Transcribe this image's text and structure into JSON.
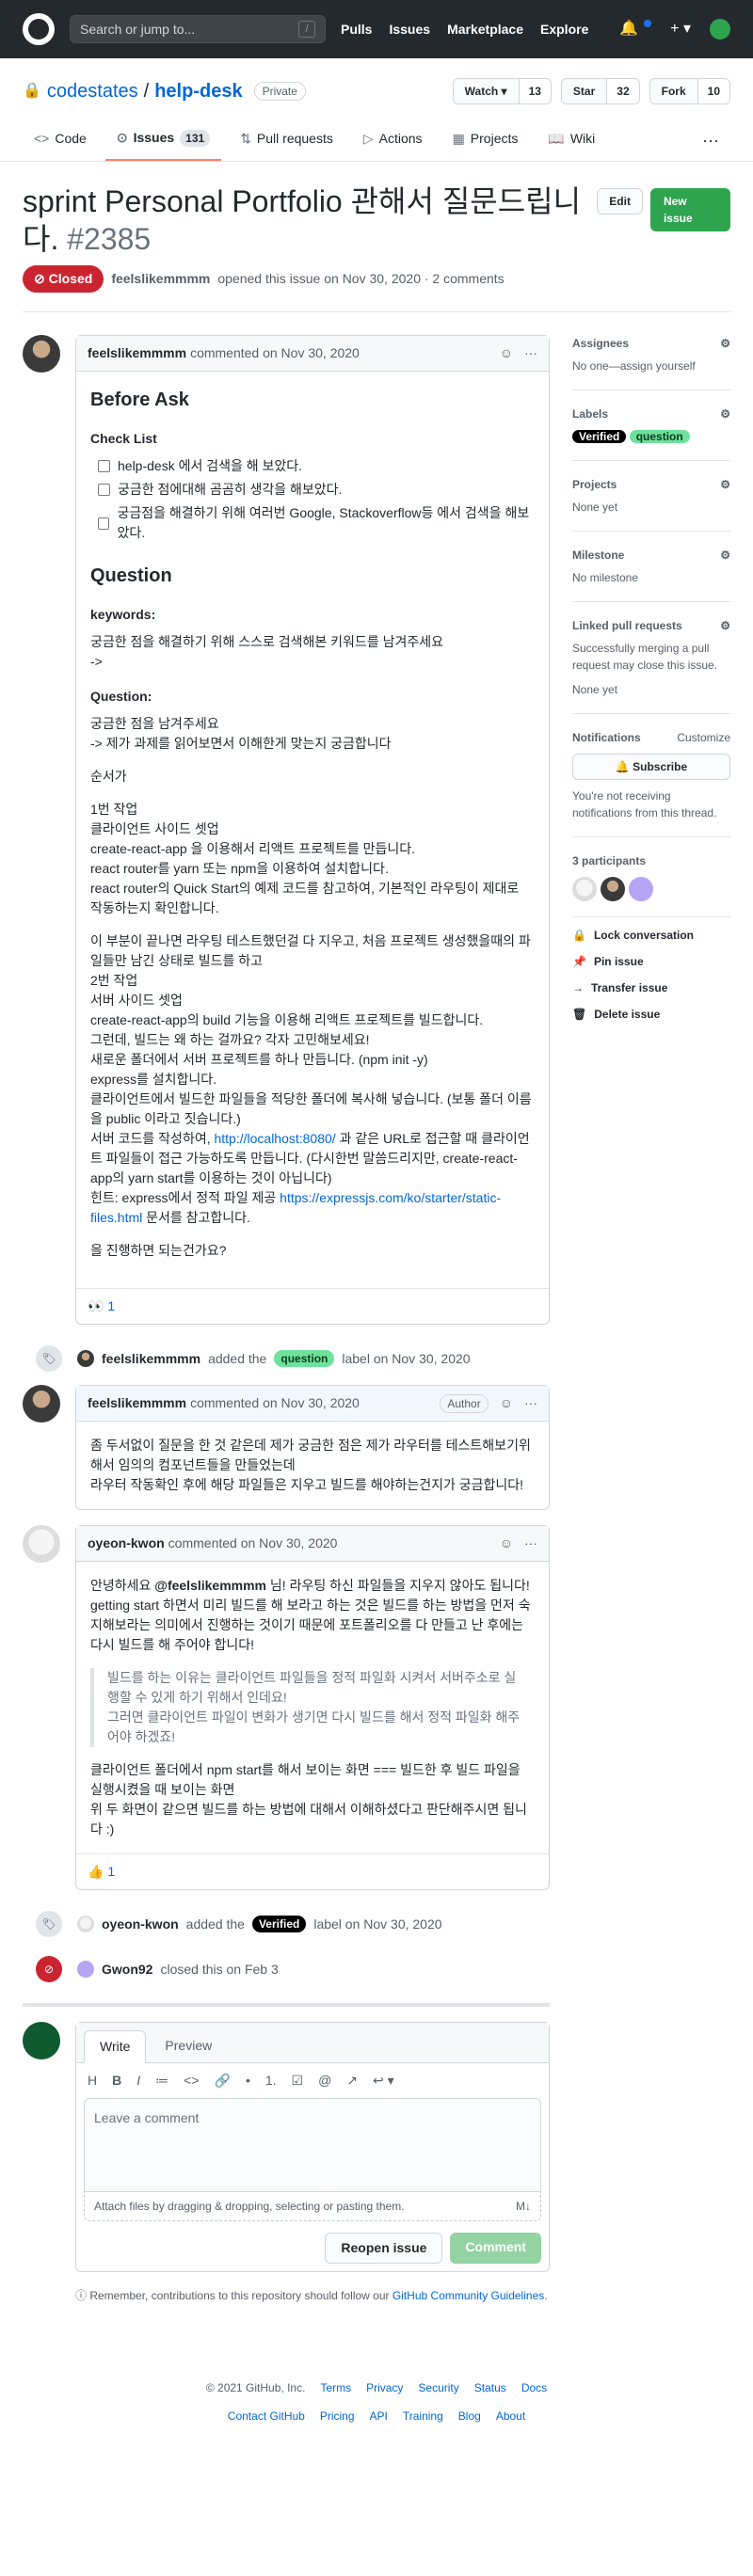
{
  "header": {
    "search_placeholder": "Search or jump to...",
    "slash": "/",
    "nav": [
      "Pulls",
      "Issues",
      "Marketplace",
      "Explore"
    ],
    "plus": "+ ▾"
  },
  "repo": {
    "owner": "codestates",
    "name": "help-desk",
    "visibility": "Private",
    "watch": "Watch ▾",
    "watch_count": "13",
    "star": "Star",
    "star_count": "32",
    "fork": "Fork",
    "fork_count": "10"
  },
  "tabs": {
    "code": "Code",
    "issues": "Issues",
    "issues_count": "131",
    "pulls": "Pull requests",
    "actions": "Actions",
    "projects": "Projects",
    "wiki": "Wiki"
  },
  "issue": {
    "title": "sprint Personal Portfolio 관해서 질문드립니다.",
    "number": "#2385",
    "edit": "Edit",
    "new_issue": "New issue",
    "status": "Closed",
    "author": "feelslikemmmm",
    "meta": "opened this issue on Nov 30, 2020 · 2 comments"
  },
  "c1": {
    "author": "feelslikemmmm",
    "meta": "commented on Nov 30, 2020",
    "h_before": "Before Ask",
    "h_check": "Check List",
    "checks": [
      "help-desk 에서 검색을 해 보았다.",
      "궁금한 점에대해 곰곰히 생각을 해보았다.",
      "궁금점을 해결하기 위해 여러번 Google, Stackoverflow등 에서 검색을 해보았다."
    ],
    "h_question": "Question",
    "h_keywords": "keywords:",
    "kw1": "궁금한 점을 해결하기 위해 스스로 검색해본 키워드를 남겨주세요",
    "kw2": "->",
    "h_q2": "Question:",
    "q1": "궁금한 점을 남겨주세요",
    "q2": "-> 제가 과제를 읽어보면서 이해한게 맞는지 궁금합니다",
    "order": "순서가",
    "s1": "1번 작업",
    "s2": "클라이언트 사이드 셋업",
    "s3": "create-react-app 을 이용해서 리액트 프로젝트를 만듭니다.",
    "s4": "react router를 yarn 또는 npm을 이용하여 설치합니다.",
    "s5": "react router의 Quick Start의 예제 코드를 참고하여, 기본적인 라우팅이 제대로 작동하는지 확인합니다.",
    "t1": "이 부분이 끝나면 라우팅 테스트했던걸 다 지우고, 처음 프로젝트 생성했을때의 파일들만 남긴 상태로 빌드를 하고",
    "t2": "2번 작업",
    "t3": "서버 사이드 셋업",
    "t4": "create-react-app의 build 기능을 이용해 리액트 프로젝트를 빌드합니다.",
    "t5": "그런데, 빌드는 왜 하는 걸까요? 각자 고민해보세요!",
    "t6": "새로운 폴더에서 서버 프로젝트를 하나 만듭니다. (npm init -y)",
    "t7": "express를 설치합니다.",
    "t8": "클라이언트에서 빌드한 파일들을 적당한 폴더에 복사해 넣습니다. (보통 폴더 이름을 public 이라고 짓습니다.)",
    "t9a": "서버 코드를 작성하여,",
    "t9link": "http://localhost:8080/",
    "t9b": "과 같은 URL로 접근할 때 클라이언트 파일들이 접근 가능하도록 만듭니다. (다시한번 말씀드리지만, create-react-app의 yarn start를 이용하는 것이 아닙니다)",
    "t10a": "힌트: express에서 정적 파일 제공",
    "t10link": "https://expressjs.com/ko/starter/static-files.html",
    "t10b": "문서를 참고합니다.",
    "ask": "을 진행하면 되는건가요?",
    "reaction": "👀 1"
  },
  "e1": {
    "actor": "feelslikemmmm",
    "a": "added the",
    "label": "question",
    "b": "label on Nov 30, 2020"
  },
  "c2": {
    "author": "feelslikemmmm",
    "meta": "commented on Nov 30, 2020",
    "badge": "Author",
    "l1": "좀 두서없이 질문을 한 것 같은데 제가 궁금한 점은 제가 라우터를 테스트해보기위해서 임의의 컴포넌트들을 만들었는데",
    "l2": "라우터 작동확인 후에 해당 파일들은 지우고 빌드를 해야하는건지가 궁금합니다!"
  },
  "c3": {
    "author": "oyeon-kwon",
    "meta": "commented on Nov 30, 2020",
    "p1a": "안녕하세요",
    "mention": "@feelslikemmmm",
    "p1b": "님! 라우팅 하신 파일들을 지우지 않아도 됩니다! getting start 하면서 미리 빌드를 해 보라고 하는 것은 빌드를 하는 방법을 먼저 숙지해보라는 의미에서 진행하는 것이기 때문에 포트폴리오를 다 만들고 난 후에는 다시 빌드를 해 주어야 합니다!",
    "q1": "빌드를 하는 이유는 클라이언트 파일들을 정적 파일화 시켜서 서버주소로 실행할 수 있게 하기 위해서 인데요!",
    "q2": "그러면 클라이언트 파일이 변화가 생기면 다시 빌드를 해서 정적 파일화 해주어야 하겠죠!",
    "p2": "클라이언트 폴더에서 npm start를 해서 보이는 화면 === 빌드한 후 빌드 파일을 실행시켰을 때 보이는 화면",
    "p3": "위 두 화면이 같으면 빌드를 하는 방법에 대해서 이해하셨다고 판단해주시면 됩니다 :)",
    "reaction": "👍 1"
  },
  "e2": {
    "actor": "oyeon-kwon",
    "a": "added the",
    "label": "Verified",
    "b": "label on Nov 30, 2020"
  },
  "e3": {
    "actor": "Gwon92",
    "text": "closed this on Feb 3"
  },
  "form": {
    "write": "Write",
    "preview": "Preview",
    "tools": [
      "H",
      "B",
      "I",
      "≔",
      "<>",
      "🔗",
      "•",
      "1.",
      "☑",
      "@",
      "↗",
      "↩ ▾"
    ],
    "placeholder": "Leave a comment",
    "attach": "Attach files by dragging & dropping, selecting or pasting them.",
    "md": "M↓",
    "reopen": "Reopen issue",
    "comment": "Comment",
    "remember_a": "Remember, contributions to this repository should follow our",
    "remember_link": "GitHub Community Guidelines",
    "remember_b": "."
  },
  "sidebar": {
    "assignees": "Assignees",
    "assignees_val": "No one—assign yourself",
    "labels": "Labels",
    "label1": "Verified",
    "label2": "question",
    "projects": "Projects",
    "projects_val": "None yet",
    "milestone": "Milestone",
    "milestone_val": "No milestone",
    "linked": "Linked pull requests",
    "linked_desc": "Successfully merging a pull request may close this issue.",
    "linked_val": "None yet",
    "notif": "Notifications",
    "customize": "Customize",
    "subscribe": "Subscribe",
    "notif_desc": "You're not receiving notifications from this thread.",
    "participants": "3 participants",
    "lock": "Lock conversation",
    "pin": "Pin issue",
    "transfer": "Transfer issue",
    "delete": "Delete issue"
  },
  "footer": {
    "copy": "© 2021 GitHub, Inc.",
    "row1": [
      "Terms",
      "Privacy",
      "Security",
      "Status",
      "Docs"
    ],
    "row2": [
      "Contact GitHub",
      "Pricing",
      "API",
      "Training",
      "Blog",
      "About"
    ]
  }
}
